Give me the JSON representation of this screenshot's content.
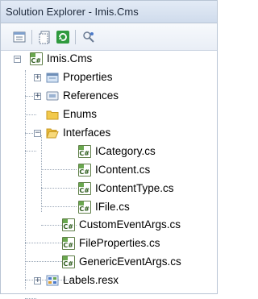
{
  "window": {
    "title": "Solution Explorer - Imis.Cms"
  },
  "toolbar": {
    "buttons": [
      {
        "icon": "properties-icon"
      },
      {
        "icon": "show-all-files-icon"
      },
      {
        "icon": "refresh-icon"
      },
      {
        "icon": "view-class-diagram-icon"
      }
    ]
  },
  "tree": {
    "project": {
      "label": "Imis.Cms",
      "expanded": true
    },
    "items": [
      {
        "label": "Properties",
        "icon": "properties-folder-icon",
        "expander": "+"
      },
      {
        "label": "References",
        "icon": "references-icon",
        "expander": "+"
      },
      {
        "label": "Enums",
        "icon": "folder-icon",
        "expander": ""
      },
      {
        "label": "Interfaces",
        "icon": "open-folder-icon",
        "expander": "-"
      },
      {
        "label": "ICategory.cs",
        "icon": "csharp-file-icon"
      },
      {
        "label": "IContent.cs",
        "icon": "csharp-file-icon"
      },
      {
        "label": "IContentType.cs",
        "icon": "csharp-file-icon"
      },
      {
        "label": "IFile.cs",
        "icon": "csharp-file-icon"
      },
      {
        "label": "CustomEventArgs.cs",
        "icon": "csharp-file-icon"
      },
      {
        "label": "FileProperties.cs",
        "icon": "csharp-file-icon"
      },
      {
        "label": "GenericEventArgs.cs",
        "icon": "csharp-file-icon"
      },
      {
        "label": "Labels.resx",
        "icon": "resource-file-icon",
        "expander": "+"
      }
    ]
  },
  "colors": {
    "folder": "#f2c94c",
    "csharp_green": "#6aa84f",
    "link": "#1c3f7a"
  }
}
